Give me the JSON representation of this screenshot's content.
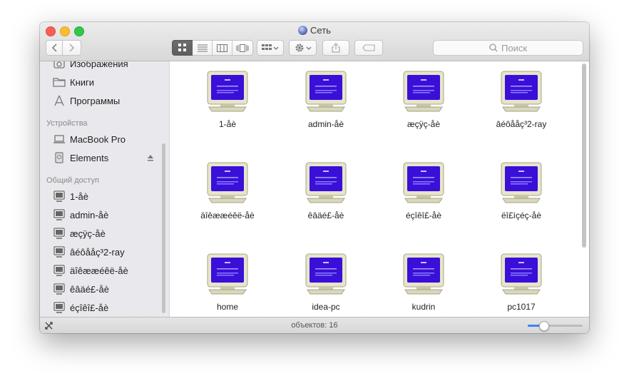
{
  "window": {
    "title": "Сеть",
    "globe_icon": "network-globe-icon"
  },
  "toolbar": {
    "back_icon": "chevron-left-icon",
    "forward_icon": "chevron-right-icon",
    "view_modes": [
      "icon-view",
      "list-view",
      "column-view",
      "cover-flow-view"
    ],
    "active_view": "icon-view",
    "search_placeholder": "Поиск"
  },
  "sidebar": {
    "top_items": [
      {
        "label": "Изображения",
        "icon": "camera-icon"
      },
      {
        "label": "Книги",
        "icon": "folder-icon"
      },
      {
        "label": "Программы",
        "icon": "applications-icon"
      }
    ],
    "devices_header": "Устройства",
    "devices": [
      {
        "label": "MacBook Pro",
        "icon": "laptop-icon"
      },
      {
        "label": "Elements",
        "icon": "drive-icon",
        "eject": true
      }
    ],
    "shared_header": "Общий доступ",
    "shared": [
      {
        "label": "1-åè"
      },
      {
        "label": "admin-åè"
      },
      {
        "label": "æçÿç-åè"
      },
      {
        "label": "âéôååç³2-ray"
      },
      {
        "label": "äîêææéêë-åè"
      },
      {
        "label": "êâäé£-åè"
      },
      {
        "label": "éçîêî£-åè"
      }
    ]
  },
  "content": {
    "items": [
      {
        "label": "1-åè"
      },
      {
        "label": "admin-åè"
      },
      {
        "label": "æçÿç-åè"
      },
      {
        "label": "âéôååç³2-ray"
      },
      {
        "label": "äîêææéêë-åè"
      },
      {
        "label": "êâäé£-åè"
      },
      {
        "label": "éçîêî£-åè"
      },
      {
        "label": "ëî£ìçéç-åè"
      },
      {
        "label": "home"
      },
      {
        "label": "idea-pc"
      },
      {
        "label": "kudrin"
      },
      {
        "label": "pc1017"
      }
    ]
  },
  "status": {
    "count_text": "объектов: 16",
    "zoom_level": 0.28
  },
  "colors": {
    "accent": "#3b82f6",
    "screen": "#3a0fd8"
  }
}
